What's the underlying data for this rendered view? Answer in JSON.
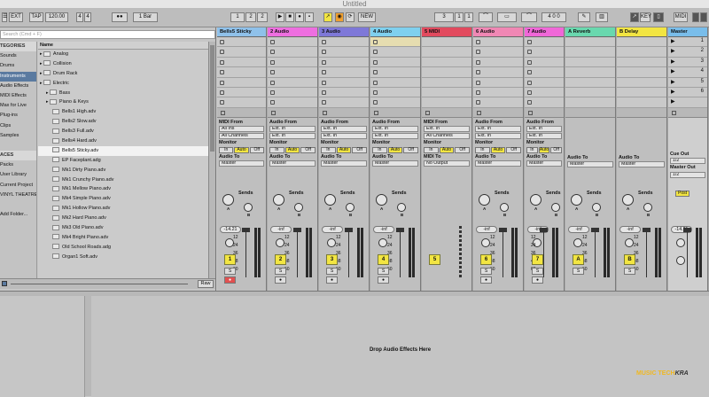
{
  "window": {
    "title": "Untitled"
  },
  "toolbar": {
    "ext": "EXT",
    "tap": "TAP",
    "tempo": "120.00",
    "sig_num": "4",
    "sig_den": "4",
    "metro": "●●",
    "quant": "1 Bar",
    "pos1": "1",
    "pos2": "2",
    "pos3": "2",
    "new": "NEW",
    "loop_start": "3",
    "loop_mid": "1",
    "loop_end": "1",
    "key": "KEY",
    "midi": "MIDI"
  },
  "browser": {
    "search_placeholder": "Search (Cmd + F)",
    "name_header": "Name",
    "raw": "Raw",
    "categories": [
      {
        "label": "TEGORIES",
        "type": "hd"
      },
      {
        "label": "Sounds",
        "type": ""
      },
      {
        "label": "Drums",
        "type": ""
      },
      {
        "label": "Instruments",
        "type": "sel"
      },
      {
        "label": "Audio Effects",
        "type": ""
      },
      {
        "label": "MIDI Effects",
        "type": ""
      },
      {
        "label": "Max for Live",
        "type": ""
      },
      {
        "label": "Plug-ins",
        "type": ""
      },
      {
        "label": "Clips",
        "type": ""
      },
      {
        "label": "Samples",
        "type": ""
      },
      {
        "label": "",
        "type": ""
      },
      {
        "label": "ACES",
        "type": "hd"
      },
      {
        "label": "Packs",
        "type": ""
      },
      {
        "label": "User Library",
        "type": ""
      },
      {
        "label": "Current Project",
        "type": ""
      },
      {
        "label": "VINYL THEATRE",
        "type": ""
      },
      {
        "label": "",
        "type": ""
      },
      {
        "label": "Add Folder...",
        "type": ""
      }
    ],
    "files": [
      {
        "label": "Analog",
        "depth": 0,
        "sel": false
      },
      {
        "label": "Collision",
        "depth": 0,
        "sel": false
      },
      {
        "label": "Drum Rack",
        "depth": 0,
        "sel": false
      },
      {
        "label": "Electric",
        "depth": 0,
        "sel": false
      },
      {
        "label": "Bass",
        "depth": 1,
        "sel": false
      },
      {
        "label": "Piano & Keys",
        "depth": 1,
        "sel": false
      },
      {
        "label": "Bells1 High.adv",
        "depth": 2,
        "sel": false
      },
      {
        "label": "Bells2 Slow.adv",
        "depth": 2,
        "sel": false
      },
      {
        "label": "Bells3 Full.adv",
        "depth": 2,
        "sel": false
      },
      {
        "label": "Bells4 Hard.adv",
        "depth": 2,
        "sel": false
      },
      {
        "label": "Bells5 Sticky.adv",
        "depth": 2,
        "sel": true
      },
      {
        "label": "EP Faceplant.adg",
        "depth": 2,
        "sel": false
      },
      {
        "label": "Mk1 Dirty Piano.adv",
        "depth": 2,
        "sel": false
      },
      {
        "label": "Mk1 Crunchy Piano.adv",
        "depth": 2,
        "sel": false
      },
      {
        "label": "Mk1 Mellow Piano.adv",
        "depth": 2,
        "sel": false
      },
      {
        "label": "Mk4 Simple Piano.adv",
        "depth": 2,
        "sel": false
      },
      {
        "label": "Mk1 Hollow Piano.adv",
        "depth": 2,
        "sel": false
      },
      {
        "label": "Mk2 Hard Piano.adv",
        "depth": 2,
        "sel": false
      },
      {
        "label": "Mk3 Old Piano.adv",
        "depth": 2,
        "sel": false
      },
      {
        "label": "Mk4 Bright Piano.adv",
        "depth": 2,
        "sel": false
      },
      {
        "label": "Old School Roads.adg",
        "depth": 2,
        "sel": false
      },
      {
        "label": "Organ1 Soft.adv",
        "depth": 2,
        "sel": false
      }
    ]
  },
  "labels": {
    "midi_from": "MIDI From",
    "audio_from": "Audio From",
    "monitor": "Monitor",
    "audio_to": "Audio To",
    "midi_to": "MIDI To",
    "sends": "Sends",
    "in": "In",
    "auto": "Auto",
    "off": "Off",
    "all_ins": "All Ins",
    "ext_in": "Ext. In",
    "all_channels": "All Channels",
    "master": "Master",
    "no_output": "No Output",
    "cue_out": "Cue Out",
    "master_out": "Master Out",
    "cue_val": "1/2",
    "post": "Post",
    "a": "A",
    "b": "B",
    "s": "S",
    "drop": "Drop Audio Effects Here"
  },
  "tracks": [
    {
      "name": "Bells5 Sticky",
      "color": "#8fc1ea",
      "kind": "midi",
      "num": "1",
      "vol": "-14.21",
      "rec": true,
      "filled": false
    },
    {
      "name": "2 Audio",
      "color": "#ee6ee0",
      "kind": "audio",
      "num": "2",
      "vol": "-inf",
      "rec": false,
      "filled": false
    },
    {
      "name": "3 Audio",
      "color": "#7e78d8",
      "kind": "audio",
      "num": "3",
      "vol": "-inf",
      "rec": false,
      "filled": false
    },
    {
      "name": "4 Audio",
      "color": "#7fd0ee",
      "kind": "audio",
      "num": "4",
      "vol": "-inf",
      "rec": false,
      "filled": true
    },
    {
      "name": "5 MIDI",
      "color": "#e24a5e",
      "kind": "group",
      "num": "5",
      "vol": "",
      "rec": false,
      "filled": false
    },
    {
      "name": "6 Audio",
      "color": "#f087b4",
      "kind": "audio",
      "num": "6",
      "vol": "-inf",
      "rec": false,
      "filled": false
    },
    {
      "name": "7 Audio",
      "color": "#f067d8",
      "kind": "audio",
      "num": "7",
      "vol": "-inf",
      "rec": false,
      "filled": false
    },
    {
      "name": "A Reverb",
      "color": "#69d8ae",
      "kind": "return",
      "num": "A",
      "vol": "-inf",
      "rec": false,
      "filled": false
    },
    {
      "name": "B Delay",
      "color": "#f2e542",
      "kind": "return",
      "num": "B",
      "vol": "-inf",
      "rec": false,
      "filled": false
    },
    {
      "name": "Master",
      "color": "#79bdea",
      "kind": "master",
      "num": "",
      "vol": "-14.21",
      "rec": false,
      "filled": false
    }
  ],
  "scene_numbers": [
    "1",
    "2",
    "3",
    "4",
    "5",
    "6"
  ],
  "meter_scale": [
    "12",
    "24",
    "36",
    "48",
    "60"
  ],
  "watermark": {
    "a": "MUSIC TECH",
    "b": "KRA"
  }
}
